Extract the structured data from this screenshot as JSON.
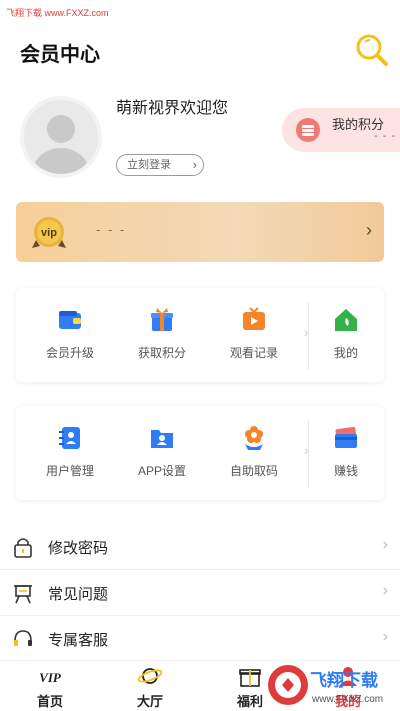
{
  "watermark_top": "飞翔下载 www.FXXZ.com",
  "header": {
    "title": "会员中心"
  },
  "profile": {
    "welcome": "萌新视界欢迎您",
    "login_label": "立刻登录"
  },
  "points": {
    "label": "我的积分",
    "value": "- - -"
  },
  "vip": {
    "badge_text": "vip",
    "value": "- - -"
  },
  "grid1": [
    {
      "label": "会员升级",
      "icon": "wallet-icon"
    },
    {
      "label": "获取积分",
      "icon": "gift-icon"
    },
    {
      "label": "观看记录",
      "icon": "tv-play-icon"
    },
    {
      "label": "我的",
      "icon": "home-icon"
    }
  ],
  "grid2": [
    {
      "label": "用户管理",
      "icon": "contacts-book-icon"
    },
    {
      "label": "APP设置",
      "icon": "folder-user-icon"
    },
    {
      "label": "自助取码",
      "icon": "flower-icon"
    },
    {
      "label": "赚钱",
      "icon": "card-icon"
    }
  ],
  "menu": [
    {
      "label": "修改密码",
      "icon": "lock-icon"
    },
    {
      "label": "常见问题",
      "icon": "easel-icon"
    },
    {
      "label": "专属客服",
      "icon": "headset-icon"
    }
  ],
  "tabs": [
    {
      "label": "首页",
      "icon": "vip-icon"
    },
    {
      "label": "大厅",
      "icon": "planet-icon"
    },
    {
      "label": "福利",
      "icon": "gift-tab-icon"
    },
    {
      "label": "我的",
      "icon": "user-tab-icon"
    }
  ],
  "watermark_logo": {
    "text": "飞翔下载",
    "url": "www.FXXZ.com"
  },
  "colors": {
    "accent_vip": "#f6cf9a",
    "points_bg": "#fde3e2",
    "blue": "#2f7df6",
    "orange": "#f5842a",
    "green": "#33b24a"
  }
}
